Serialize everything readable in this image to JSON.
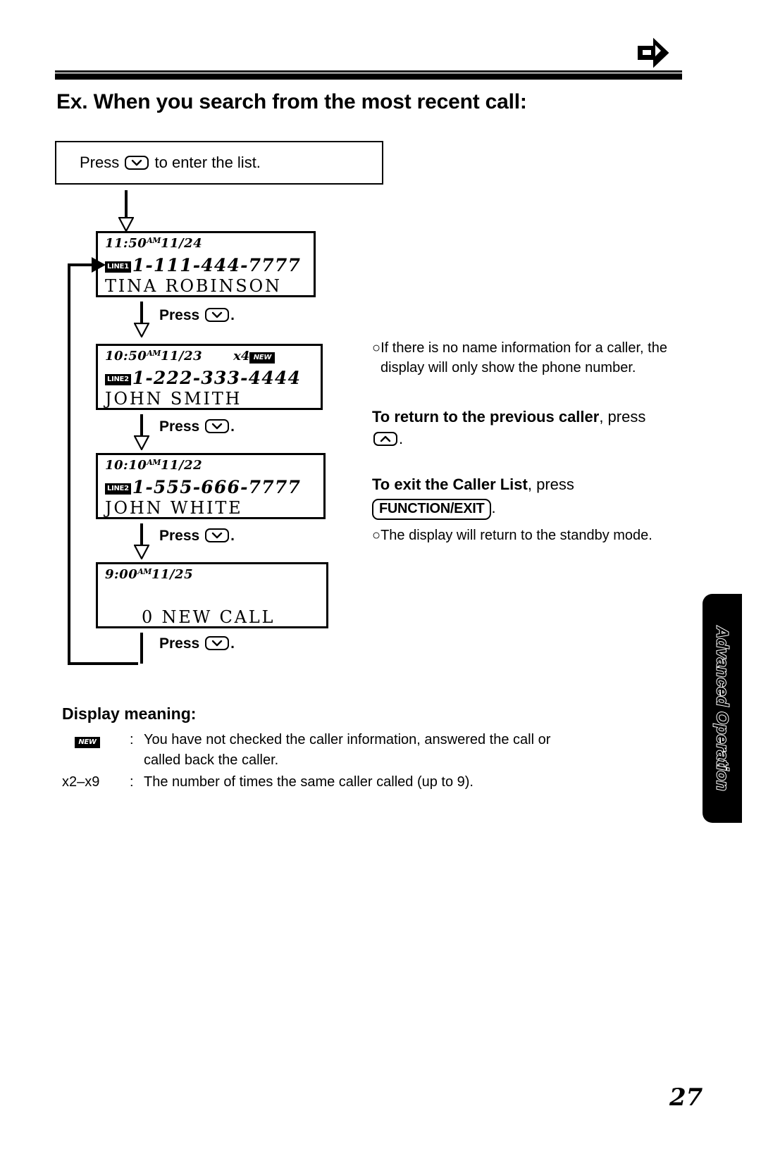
{
  "page": {
    "number": "27",
    "corner_icon": "right-arrow-icon",
    "side_tab_label": "Advanced Operation"
  },
  "section": {
    "title": "Ex. When you search from the most recent call:"
  },
  "flow": {
    "intro": {
      "prefix": "Press",
      "key": "down-arrow-key",
      "suffix": "to enter the list."
    },
    "step_label_prefix": "Press",
    "step_label_suffix": ".",
    "displays": [
      {
        "time": "11:50",
        "ampm": "AM",
        "date": "11/24",
        "count": "",
        "new_badge": "",
        "line_badge": "LINE1",
        "number": "1-111-444-7777",
        "name": "TINA  ROBINSON"
      },
      {
        "time": "10:50",
        "ampm": "AM",
        "date": "11/23",
        "count": "x4",
        "new_badge": "NEW",
        "line_badge": "LINE2",
        "number": "1-222-333-4444",
        "name": "JOHN  SMITH"
      },
      {
        "time": "10:10",
        "ampm": "AM",
        "date": "11/22",
        "count": "",
        "new_badge": "",
        "line_badge": "LINE2",
        "number": "1-555-666-7777",
        "name": "JOHN  WHITE"
      },
      {
        "time": "9:00",
        "ampm": "AM",
        "date": "11/25",
        "count": "",
        "new_badge": "",
        "line_badge": "",
        "number": "",
        "name": "0  NEW  CALL"
      }
    ]
  },
  "notes": {
    "no_name": "If there is no name information for a caller, the display will only show the phone number.",
    "return_heading": "To return to the previous caller",
    "return_rest": ", press",
    "return_key": "up-arrow-key",
    "return_end": ".",
    "exit_heading": "To exit the Caller List",
    "exit_rest": ", press",
    "exit_key_label": "FUNCTION/EXIT",
    "exit_end": ".",
    "standby": "The display will return to the standby mode."
  },
  "display_meaning": {
    "title": "Display meaning:",
    "rows": [
      {
        "key_badge": "NEW",
        "key_text": "",
        "colon": ":",
        "text": "You have not checked the caller information, answered the call or",
        "text_cont": "called back the caller."
      },
      {
        "key_badge": "",
        "key_text": "x2–x9",
        "colon": ":",
        "text": "The number of times the same caller called (up to 9).",
        "text_cont": ""
      }
    ]
  }
}
